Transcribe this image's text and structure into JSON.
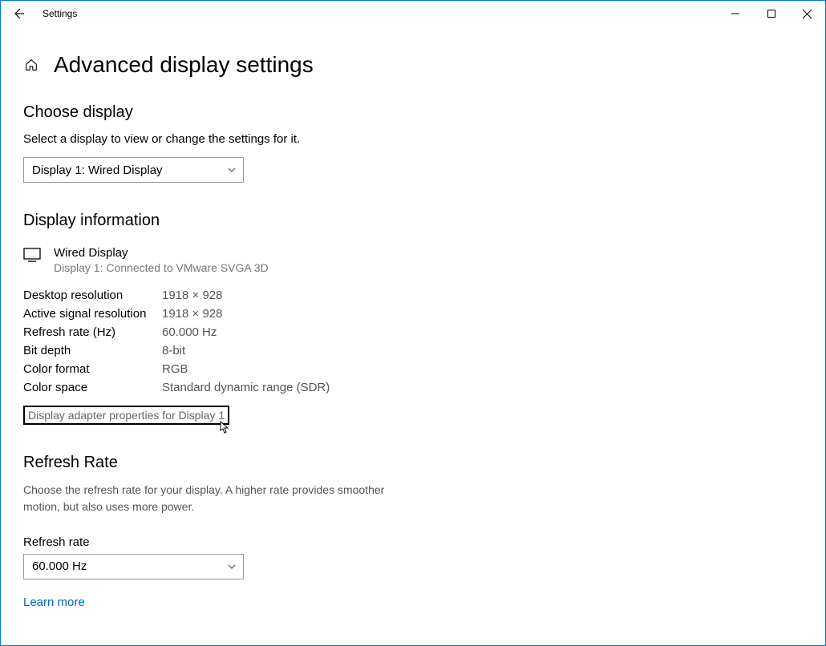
{
  "window": {
    "title": "Settings"
  },
  "page": {
    "title": "Advanced display settings"
  },
  "choose_display": {
    "header": "Choose display",
    "desc": "Select a display to view or change the settings for it.",
    "selected": "Display 1: Wired Display"
  },
  "display_info": {
    "header": "Display information",
    "name": "Wired Display",
    "sub": "Display 1: Connected to VMware SVGA 3D",
    "rows": [
      {
        "label": "Desktop resolution",
        "value": "1918 × 928"
      },
      {
        "label": "Active signal resolution",
        "value": "1918 × 928"
      },
      {
        "label": "Refresh rate (Hz)",
        "value": "60.000 Hz"
      },
      {
        "label": "Bit depth",
        "value": "8-bit"
      },
      {
        "label": "Color format",
        "value": "RGB"
      },
      {
        "label": "Color space",
        "value": "Standard dynamic range (SDR)"
      }
    ],
    "adapter_link": "Display adapter properties for Display 1"
  },
  "refresh": {
    "header": "Refresh Rate",
    "desc": "Choose the refresh rate for your display. A higher rate provides smoother motion, but also uses more power.",
    "label": "Refresh rate",
    "selected": "60.000 Hz",
    "learn_more": "Learn more"
  }
}
